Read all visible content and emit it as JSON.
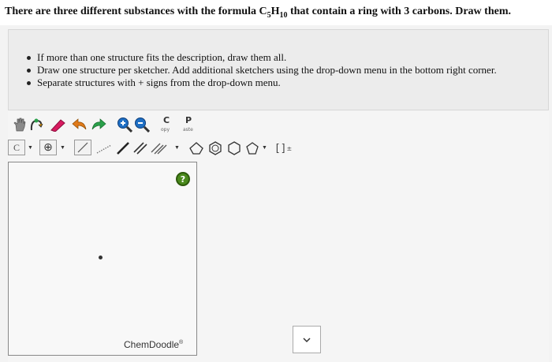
{
  "question": {
    "part1": "There are three different substances with the formula C",
    "sub1": "5",
    "part2": "H",
    "sub2": "10",
    "part3": " that contain a ring with 3 carbons. Draw them."
  },
  "instructions": [
    "If more than one structure fits the description, draw them all.",
    "Draw one structure per sketcher. Add additional sketchers using the drop-down menu in the bottom right corner.",
    "Separate structures with + signs from the drop-down menu."
  ],
  "toolbar": {
    "copy_letter": "C",
    "copy_label": "opy",
    "paste_letter": "P",
    "paste_label": "aste",
    "element_label": "C",
    "charge_symbol": "⊕",
    "bracket_label": "[]",
    "bracket_sup": "±"
  },
  "sketcher": {
    "brand": "ChemDoodle",
    "brand_mark": "®",
    "help_label": "?"
  },
  "icons": [
    "hand-icon",
    "lasso-icon",
    "eraser-icon",
    "undo-icon",
    "redo-icon",
    "zoom-in-icon",
    "zoom-out-icon",
    "single-bond-icon",
    "dashed-bond-icon",
    "bold-bond-icon",
    "double-bond-icon",
    "triple-bond-icon",
    "cyclopropane-icon",
    "benzene-icon",
    "hexagon-icon",
    "pentagon-icon",
    "chevron-down-icon"
  ],
  "colors": {
    "accent_green": "#4a8a1c",
    "arrow_green": "#2aa04a",
    "eraser_pink": "#d81b60"
  }
}
